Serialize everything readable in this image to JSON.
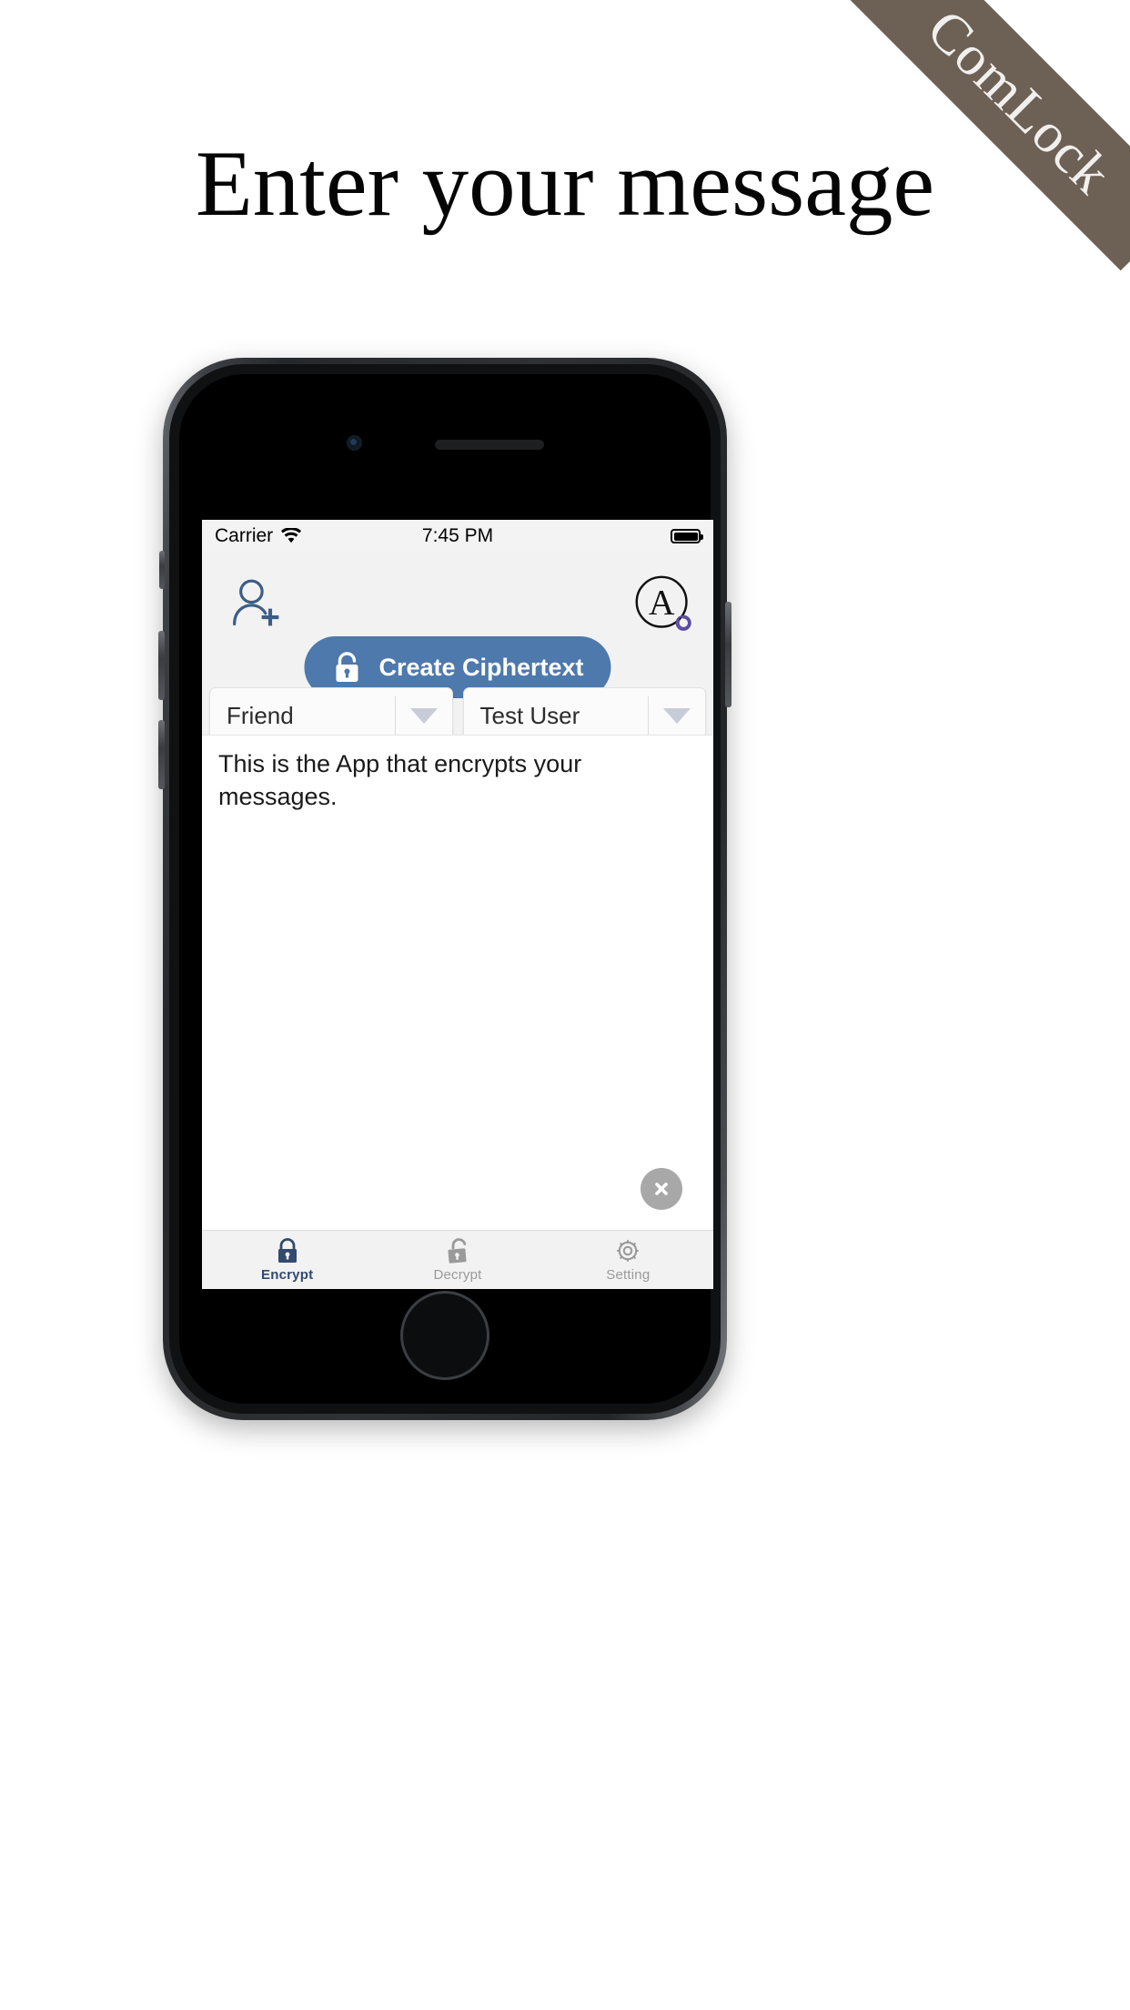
{
  "ribbon": {
    "label": "ComLock"
  },
  "headline": {
    "text": "Enter your message"
  },
  "phone": {
    "status_bar": {
      "carrier": "Carrier",
      "wifi_icon": "wifi-icon",
      "time": "7:45 PM",
      "battery_icon": "battery-full-icon"
    },
    "header": {
      "add_user_icon": "add-user-icon",
      "account_icon": "circled-a-icon",
      "primary_button": {
        "label": "Create Ciphertext",
        "icon": "lock-closed-icon",
        "color": "#4d79ac"
      }
    },
    "selectors": [
      {
        "name": "recipient-select",
        "value": "Friend",
        "arrow_icon": "chevron-down-icon"
      },
      {
        "name": "sender-select",
        "value": "Test User",
        "arrow_icon": "chevron-down-icon"
      }
    ],
    "message": {
      "value": "This is the App that encrypts your messages.",
      "clear_icon": "close-circle-icon"
    },
    "tabs": [
      {
        "label": "Encrypt",
        "icon": "lock-closed-icon",
        "active": true,
        "color": "#33496e"
      },
      {
        "label": "Decrypt",
        "icon": "lock-open-icon",
        "active": false,
        "color": "#9a9a9a"
      },
      {
        "label": "Setting",
        "icon": "gear-icon",
        "active": false,
        "color": "#9a9a9a"
      }
    ]
  }
}
